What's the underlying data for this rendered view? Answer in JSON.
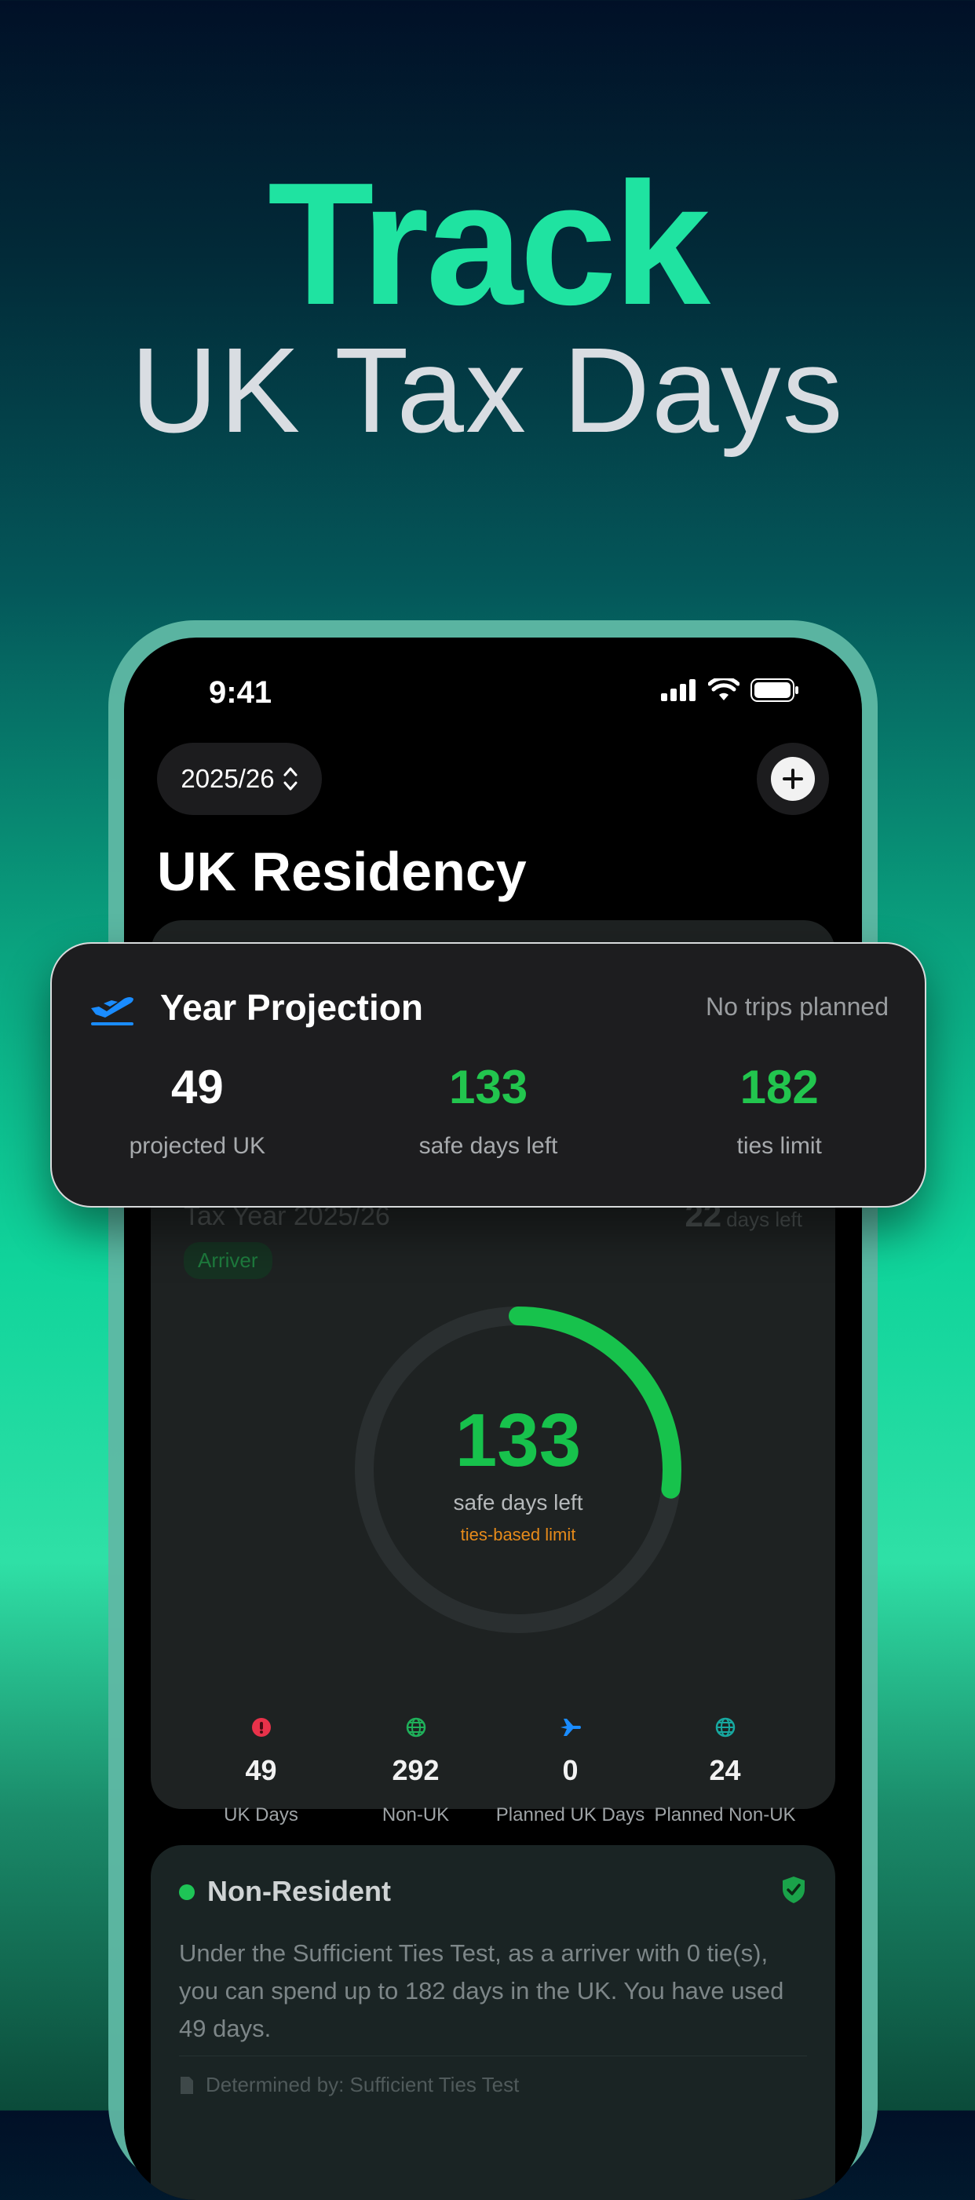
{
  "headline": {
    "title": "Track",
    "subtitle": "UK Tax Days"
  },
  "status_bar": {
    "time": "9:41"
  },
  "toolbar": {
    "year_selector": "2025/26",
    "add_icon": "plus-icon"
  },
  "page_title": "UK Residency",
  "main_card": {
    "tax_year": "Tax Year 2025/26",
    "badge": "Arriver",
    "days_left_value": "22",
    "days_left_label": "days left",
    "ring": {
      "value": "133",
      "label": "safe days left",
      "sublabel": "ties-based limit",
      "progress_fraction": 0.27,
      "color": "#17c24c"
    },
    "stats": [
      {
        "icon": "red-pin-icon",
        "value": "49",
        "label": "UK Days"
      },
      {
        "icon": "globe-icon",
        "value": "292",
        "label": "Non-UK"
      },
      {
        "icon": "plane-icon",
        "value": "0",
        "label": "Planned UK Days"
      },
      {
        "icon": "globe-icon",
        "value": "24",
        "label": "Planned Non-UK"
      }
    ]
  },
  "status_card": {
    "title": "Non-Resident",
    "description": "Under the Sufficient Ties Test, as a arriver with 0 tie(s), you can spend up to 182 days in the UK. You have used 49 days.",
    "footer": "Determined by: Sufficient Ties Test"
  },
  "projection": {
    "title": "Year Projection",
    "note": "No trips planned",
    "icon": "plane-departure-icon",
    "columns": [
      {
        "value": "49",
        "label": "projected UK",
        "color": "#ffffff"
      },
      {
        "value": "133",
        "label": "safe days left",
        "color": "#22c54e"
      },
      {
        "value": "182",
        "label": "ties limit",
        "color": "#22c54e"
      }
    ]
  },
  "colors": {
    "accent_green": "#1fe3a1",
    "safe_green": "#17c24c",
    "warning_orange": "#e58a1a",
    "plane_blue": "#1a8cff"
  }
}
